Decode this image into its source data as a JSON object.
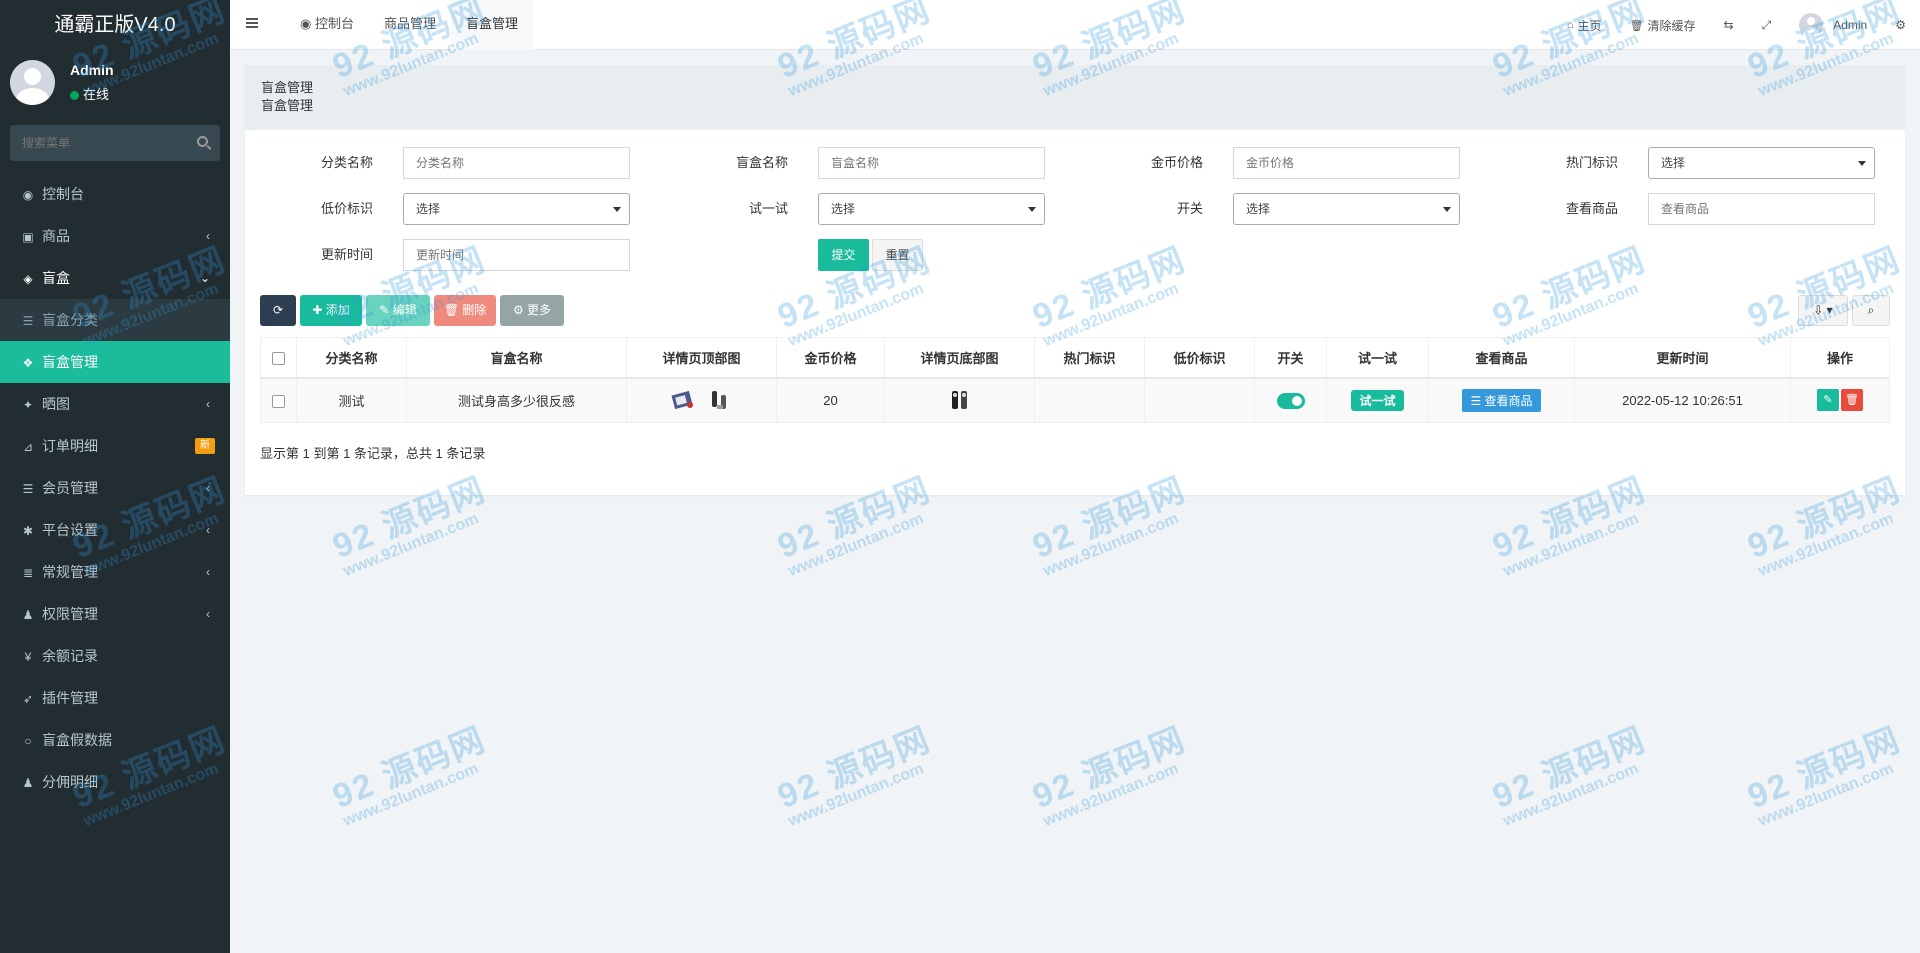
{
  "app": {
    "brand": "通霸正版V4.0",
    "user": {
      "name": "Admin",
      "status": "在线"
    },
    "menu_search_placeholder": "搜索菜单"
  },
  "sidebar": {
    "items": [
      {
        "label": "控制台",
        "icon": "dashboard-icon",
        "glyph": "◉",
        "caret": ""
      },
      {
        "label": "商品",
        "icon": "shopping-bag-icon",
        "glyph": "▣",
        "caret": "‹"
      },
      {
        "label": "盲盒",
        "icon": "cube-icon",
        "glyph": "◈",
        "caret": "⌄"
      },
      {
        "label": "盲盒分类",
        "icon": "list-icon",
        "glyph": "☰",
        "caret": ""
      },
      {
        "label": "盲盒管理",
        "icon": "cubes-icon",
        "glyph": "❖",
        "caret": ""
      },
      {
        "label": "晒图",
        "icon": "dropbox-icon",
        "glyph": "✦",
        "caret": "‹"
      },
      {
        "label": "订单明细",
        "icon": "cart-icon",
        "glyph": "⊿",
        "caret": "",
        "badge": "新"
      },
      {
        "label": "会员管理",
        "icon": "list-alt-icon",
        "glyph": "☰",
        "caret": "‹"
      },
      {
        "label": "平台设置",
        "icon": "gear-icon",
        "glyph": "✱",
        "caret": "‹"
      },
      {
        "label": "常规管理",
        "icon": "database-icon",
        "glyph": "≣",
        "caret": "‹"
      },
      {
        "label": "权限管理",
        "icon": "group-icon",
        "glyph": "♟",
        "caret": "‹"
      },
      {
        "label": "余额记录",
        "icon": "yen-icon",
        "glyph": "¥",
        "caret": ""
      },
      {
        "label": "插件管理",
        "icon": "rocket-icon",
        "glyph": "➶",
        "caret": ""
      },
      {
        "label": "盲盒假数据",
        "icon": "circle-icon",
        "glyph": "○",
        "caret": ""
      },
      {
        "label": "分佣明细",
        "icon": "users-icon",
        "glyph": "♟",
        "caret": ""
      }
    ]
  },
  "topbar": {
    "tabs": [
      "控制台",
      "商品管理",
      "盲盒管理"
    ],
    "home": "主页",
    "clear_cache": "清除缓存",
    "user": "Admin"
  },
  "panel": {
    "title": "盲盒管理",
    "subtitle": "盲盒管理"
  },
  "filters": {
    "category_label": "分类名称",
    "category_placeholder": "分类名称",
    "box_label": "盲盒名称",
    "box_placeholder": "盲盒名称",
    "price_label": "金币价格",
    "price_placeholder": "金币价格",
    "hot_label": "热门标识",
    "hot_value": "选择",
    "low_label": "低价标识",
    "low_value": "选择",
    "try_label": "试一试",
    "try_value": "选择",
    "switch_label": "开关",
    "switch_value": "选择",
    "goods_label": "查看商品",
    "goods_placeholder": "查看商品",
    "time_label": "更新时间",
    "time_placeholder": "更新时间",
    "submit": "提交",
    "reset": "重置"
  },
  "toolbar": {
    "add": "添加",
    "edit": "编辑",
    "delete": "删除",
    "more": "更多"
  },
  "table": {
    "headers": [
      "分类名称",
      "盲盒名称",
      "详情页顶部图",
      "金币价格",
      "详情页底部图",
      "热门标识",
      "低价标识",
      "开关",
      "试一试",
      "查看商品",
      "更新时间",
      "操作"
    ],
    "rows": [
      {
        "category": "测试",
        "name": "测试身高多少很反感",
        "price": "20",
        "hot": "",
        "low": "",
        "try_label": "试一试",
        "view_label": "查看商品",
        "updated": "2022-05-12 10:26:51"
      }
    ],
    "summary": "显示第 1 到第 1 条记录，总共 1 条记录"
  },
  "watermark": {
    "big": "92 源码网",
    "small": "www.92luntan.com"
  },
  "colors": {
    "accent": "#18bc9c",
    "sidebar": "#222d32",
    "danger": "#e74c3c",
    "info": "#3498db"
  }
}
